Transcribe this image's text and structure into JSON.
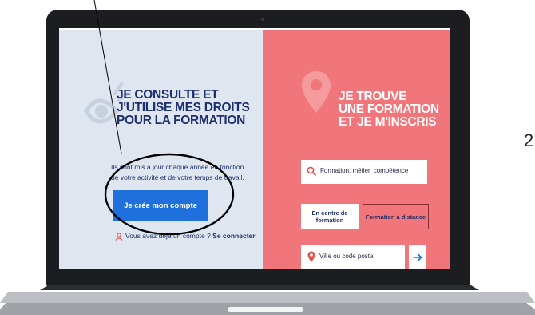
{
  "left_panel": {
    "title_lines": [
      "JE CONSULTE ET",
      "J'UTILISE MES DROITS",
      "POUR LA FORMATION"
    ],
    "text": "Ils sont mis à jour chaque année en fonction de votre activité et de votre temps de travail.",
    "create_account_button": "Je crée mon compte",
    "login_prompt": "Vous avez déjà un compte ?",
    "login_link": "Se connecter",
    "eye_icon": "eye-icon",
    "person_icon": "person-icon"
  },
  "right_panel": {
    "title_lines": [
      "JE TROUVE",
      "UNE FORMATION",
      "ET JE M'INSCRIS"
    ],
    "search_placeholder": "Formation, métier, compétence",
    "tabs": [
      "En centre de formation",
      "Formation à distance"
    ],
    "city_placeholder": "Ville ou code postal",
    "search_icon": "search-icon",
    "pin_icon": "location-pin-icon",
    "arrow_icon": "arrow-right-icon"
  },
  "side_number": "2",
  "colors": {
    "left_bg": "#dfe6f0",
    "right_bg": "#f0767b",
    "navy": "#1c2f6e",
    "button_blue": "#1f6fdd"
  }
}
